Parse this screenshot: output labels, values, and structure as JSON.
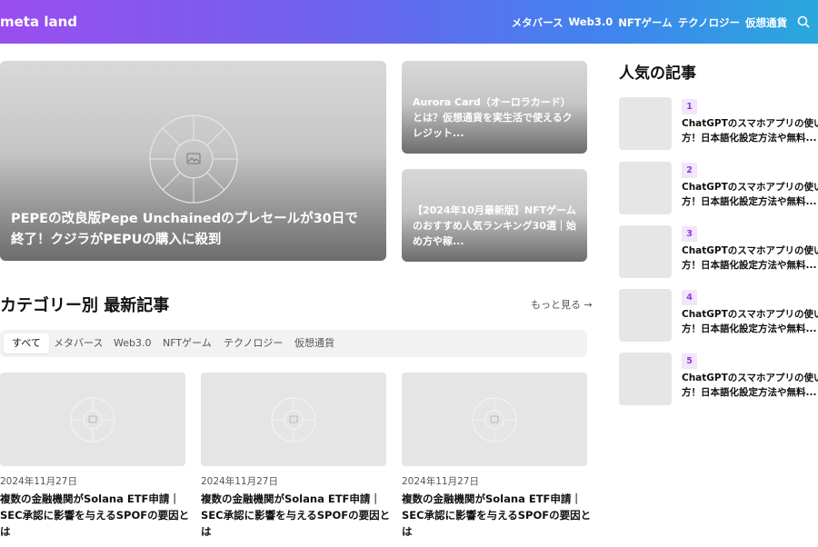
{
  "header": {
    "logo": "meta land",
    "nav": [
      "メタバース",
      "Web3.0",
      "NFTゲーム",
      "テクノロジー",
      "仮想通貨"
    ],
    "search_icon": "search-icon",
    "gradient": [
      "#9a4ef0",
      "#3f85ee",
      "#2aa8dc"
    ]
  },
  "featured": {
    "main_title": "PEPEの改良版Pepe Unchainedのプレセールが30日で終了！クジラがPEPUの購入に殺到",
    "side1_title": "Aurora Card（オーロラカード）とは？仮想通貨を実生活で使えるクレジット...",
    "side2_title": "【2024年10月最新版】NFTゲームのおすすめ人気ランキング30選｜始め方や稼..."
  },
  "section": {
    "title": "カテゴリー別 最新記事",
    "more": "もっと見る →",
    "tabs": [
      "すべて",
      "メタバース",
      "Web3.0",
      "NFTゲーム",
      "テクノロジー",
      "仮想通貨"
    ]
  },
  "cards": [
    {
      "date": "2024年11月27日",
      "title": "複数の金融機関がSolana ETF申請｜SEC承認に影響を与えるSPOFの要因とは"
    },
    {
      "date": "2024年11月27日",
      "title": "複数の金融機関がSolana ETF申請｜SEC承認に影響を与えるSPOFの要因とは"
    },
    {
      "date": "2024年11月27日",
      "title": "複数の金融機関がSolana ETF申請｜SEC承認に影響を与えるSPOFの要因とは"
    }
  ],
  "sidebar": {
    "title": "人気の記事",
    "accent": "#8a3fd8",
    "items": [
      {
        "rank": "1",
        "line1": "ChatGPTのスマホアプリの使い",
        "line2": "方！日本語化設定方法や無料..."
      },
      {
        "rank": "2",
        "line1": "ChatGPTのスマホアプリの使い",
        "line2": "方！日本語化設定方法や無料..."
      },
      {
        "rank": "3",
        "line1": "ChatGPTのスマホアプリの使い",
        "line2": "方！日本語化設定方法や無料..."
      },
      {
        "rank": "4",
        "line1": "ChatGPTのスマホアプリの使い",
        "line2": "方！日本語化設定方法や無料..."
      },
      {
        "rank": "5",
        "line1": "ChatGPTのスマホアプリの使い",
        "line2": "方！日本語化設定方法や無料..."
      }
    ]
  }
}
